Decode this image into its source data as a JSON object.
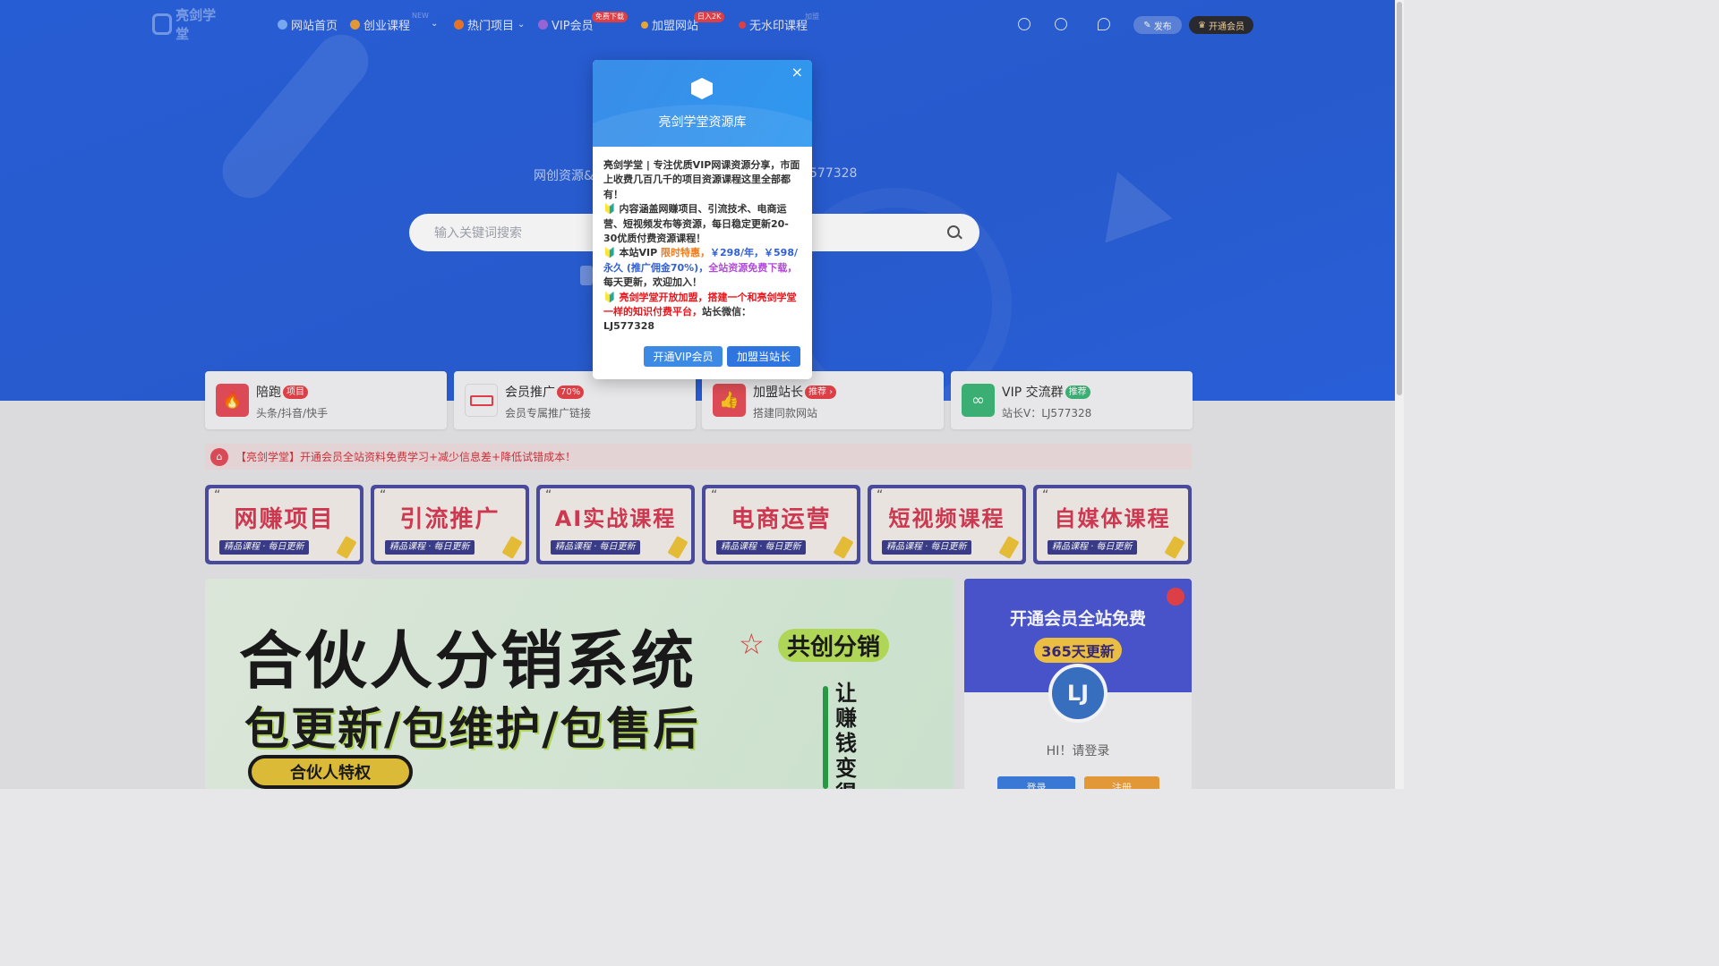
{
  "nav": {
    "logo": "亮剑学堂",
    "items": [
      {
        "label": "网站首页",
        "badge": ""
      },
      {
        "label": "创业课程",
        "badge": "NEW"
      },
      {
        "label": "热门项目",
        "badge": ""
      },
      {
        "label": "VIP会员",
        "badge": "免费下载"
      },
      {
        "label": "加盟网站",
        "badge": "日入2K"
      },
      {
        "label": "无水印课程",
        "badge": "加盟"
      }
    ],
    "publish": "发布",
    "open_vip": "开通会员"
  },
  "hero": {
    "subtitle_left": "网创资源&",
    "subtitle_right": "577328",
    "search_placeholder": "输入关键词搜索"
  },
  "features": [
    {
      "title": "陪跑",
      "badge": "项目",
      "sub": "头条/抖音/快手"
    },
    {
      "title": "会员推广",
      "badge": "70%",
      "sub": "会员专属推广链接"
    },
    {
      "title": "加盟站长",
      "badge": "推荐 ›",
      "sub": "搭建同款网站"
    },
    {
      "title": "VIP 交流群",
      "badge": "推荐",
      "sub": "站长V：LJ577328"
    }
  ],
  "notice": "【亮剑学堂】开通会员全站资料免费学习+减少信息差+降低试错成本！",
  "categories": [
    {
      "title": "网赚项目",
      "tag": "精品课程 · 每日更新"
    },
    {
      "title": "引流推广",
      "tag": "精品课程 · 每日更新"
    },
    {
      "title": "AI实战课程",
      "tag": "精品课程 · 每日更新"
    },
    {
      "title": "电商运营",
      "tag": "精品课程 · 每日更新"
    },
    {
      "title": "短视频课程",
      "tag": "精品课程 · 每日更新"
    },
    {
      "title": "自媒体课程",
      "tag": "精品课程 · 每日更新"
    }
  ],
  "banner": {
    "line1": "合伙人分销系统",
    "line2": "包更新/包维护/包售后",
    "pill": "共创分销",
    "button": "合伙人特权",
    "vertical": "让赚钱变得"
  },
  "side": {
    "title": "开通会员全站免费",
    "pill": "365天更新",
    "avatar": "LJ",
    "hi": "HI！请登录",
    "login": "登录",
    "register": "注册"
  },
  "modal": {
    "title": "亮剑学堂资源库",
    "p1": "亮剑学堂 | 专注优质VIP网课资源分享，市面上收费几百几千的项目资源课程这里全部都有！",
    "p2": "🔰 内容涵盖网赚项目、引流技术、电商运营、短视频发布等资源，每日稳定更新20-30优质付费资源课程！",
    "p3a": "🔰 本站VIP ",
    "p3b": "限时特惠，",
    "p3c": "￥298/年，￥598/永久 (推广佣金70%)，",
    "p3d": "全站资源免费下载，",
    "p3e": "每天更新，欢迎加入！",
    "p4a": "🔰 ",
    "p4b": "亮剑学堂开放加盟，搭建一个和亮剑学堂一样的知识付费平台，",
    "p4c": "站长微信：LJ577328",
    "btn_vip": "开通VIP会员",
    "btn_join": "加盟当站长",
    "close": "×"
  }
}
